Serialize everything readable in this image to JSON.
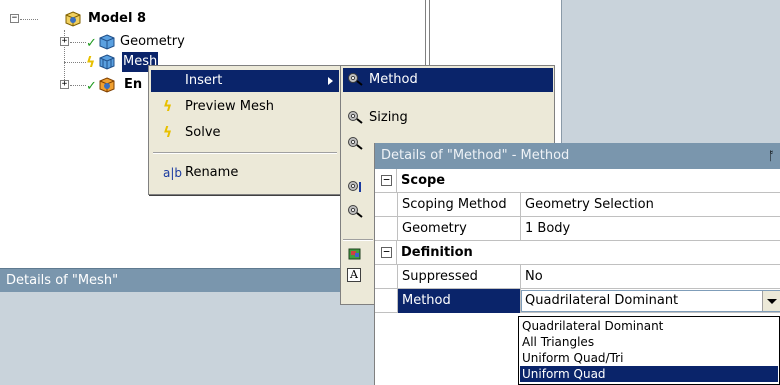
{
  "tree": {
    "items": [
      {
        "label": "Model 8"
      },
      {
        "label": "Geometry"
      },
      {
        "label": "Mesh"
      },
      {
        "label": "En"
      }
    ]
  },
  "mesh_details_title": "Details of \"Mesh\"",
  "context_menu": {
    "items": [
      {
        "label": "Insert"
      },
      {
        "label": "Preview Mesh"
      },
      {
        "label": "Solve"
      },
      {
        "label": "Rename"
      }
    ]
  },
  "submenu": {
    "items": [
      {
        "label": "Method"
      },
      {
        "label": "Sizing"
      }
    ]
  },
  "details": {
    "title": "Details of \"Method\" - Method",
    "sections": [
      {
        "title": "Scope",
        "rows": [
          {
            "key": "Scoping Method",
            "value": "Geometry Selection"
          },
          {
            "key": "Geometry",
            "value": "1 Body"
          }
        ]
      },
      {
        "title": "Definition",
        "rows": [
          {
            "key": "Suppressed",
            "value": "No"
          },
          {
            "key": "Method",
            "value": "Quadrilateral Dominant"
          }
        ]
      }
    ],
    "dropdown_options": [
      "Quadrilateral Dominant",
      "All Triangles",
      "Uniform Quad/Tri",
      "Uniform Quad"
    ]
  },
  "colors": {
    "selection": "#0a246a",
    "panel_header": "#7a96ad",
    "menu_bg": "#ece9d8",
    "background": "#c9d3db"
  }
}
